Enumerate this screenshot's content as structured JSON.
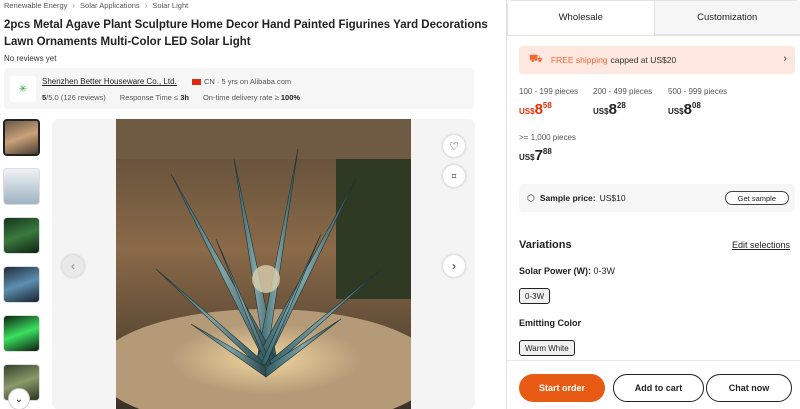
{
  "breadcrumb": [
    "Renewable Energy",
    "Solar Applications",
    "Solar Light"
  ],
  "product": {
    "title": "2pcs Metal Agave Plant Sculpture Home Decor Hand Painted Figurines Yard Decorations Lawn Ornaments Multi-Color LED Solar Light",
    "reviews": "No reviews yet"
  },
  "supplier": {
    "name": "Shenzhen Better Houseware Co., Ltd.",
    "country_meta": "CN · 5 yrs on Alibaba.com",
    "rating": "5",
    "rating_suffix": "/5.0 (126 reviews)",
    "response_label": "Response Time ≤",
    "response_value": "3h",
    "delivery_label": "On-time delivery rate ≥",
    "delivery_value": "100%"
  },
  "tabs": {
    "wholesale": "Wholesale",
    "customization": "Customization"
  },
  "shipping": {
    "free": "FREE shipping",
    "rest": "capped at US$20"
  },
  "tiers": [
    {
      "range": "100 - 199 pieces",
      "cur": "US$",
      "int": "8",
      "dec": "58"
    },
    {
      "range": "200 - 499 pieces",
      "cur": "US$",
      "int": "8",
      "dec": "28"
    },
    {
      "range": "500 - 999 pieces",
      "cur": "US$",
      "int": "8",
      "dec": "08"
    },
    {
      "range": ">= 1,000 pieces",
      "cur": "US$",
      "int": "7",
      "dec": "88"
    }
  ],
  "sample": {
    "label": "Sample price:",
    "value": "US$10",
    "button": "Get sample"
  },
  "variations": {
    "title": "Variations",
    "edit": "Edit selections",
    "power_label": "Solar Power (W):",
    "power_value": "0-3W",
    "power_chip": "0-3W",
    "color_label": "Emitting Color",
    "color_chip": "Warm White"
  },
  "actions": {
    "order": "Start order",
    "cart": "Add to cart",
    "chat": "Chat now"
  },
  "colors": {
    "accent": "#e85b14",
    "price_red": "#e62e04",
    "ship_bg": "#fde7de"
  }
}
